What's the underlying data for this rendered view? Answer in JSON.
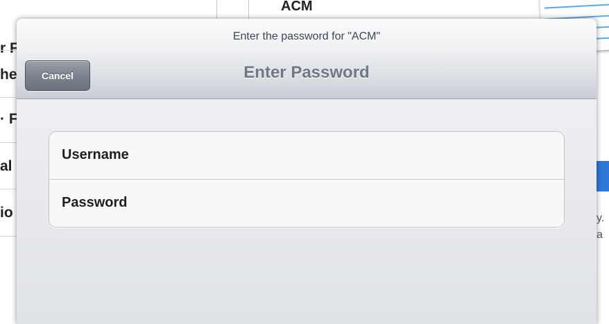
{
  "background": {
    "header_title": "ACM",
    "left_cells": [
      "r F",
      "he",
      "· F",
      "al",
      "io"
    ],
    "right_texts": [
      "y.",
      "a"
    ]
  },
  "dialog": {
    "prompt": "Enter the password for \"ACM\"",
    "title": "Enter Password",
    "cancel_label": "Cancel",
    "fields": [
      {
        "label": "Username",
        "value": "",
        "placeholder": ""
      },
      {
        "label": "Password",
        "value": "",
        "placeholder": ""
      }
    ]
  },
  "colors": {
    "title_text": "#6f7984",
    "cancel_button": "#7c838d",
    "accent_blue": "#2e78d8"
  },
  "icons": {
    "notepad": "notepad-icon"
  }
}
